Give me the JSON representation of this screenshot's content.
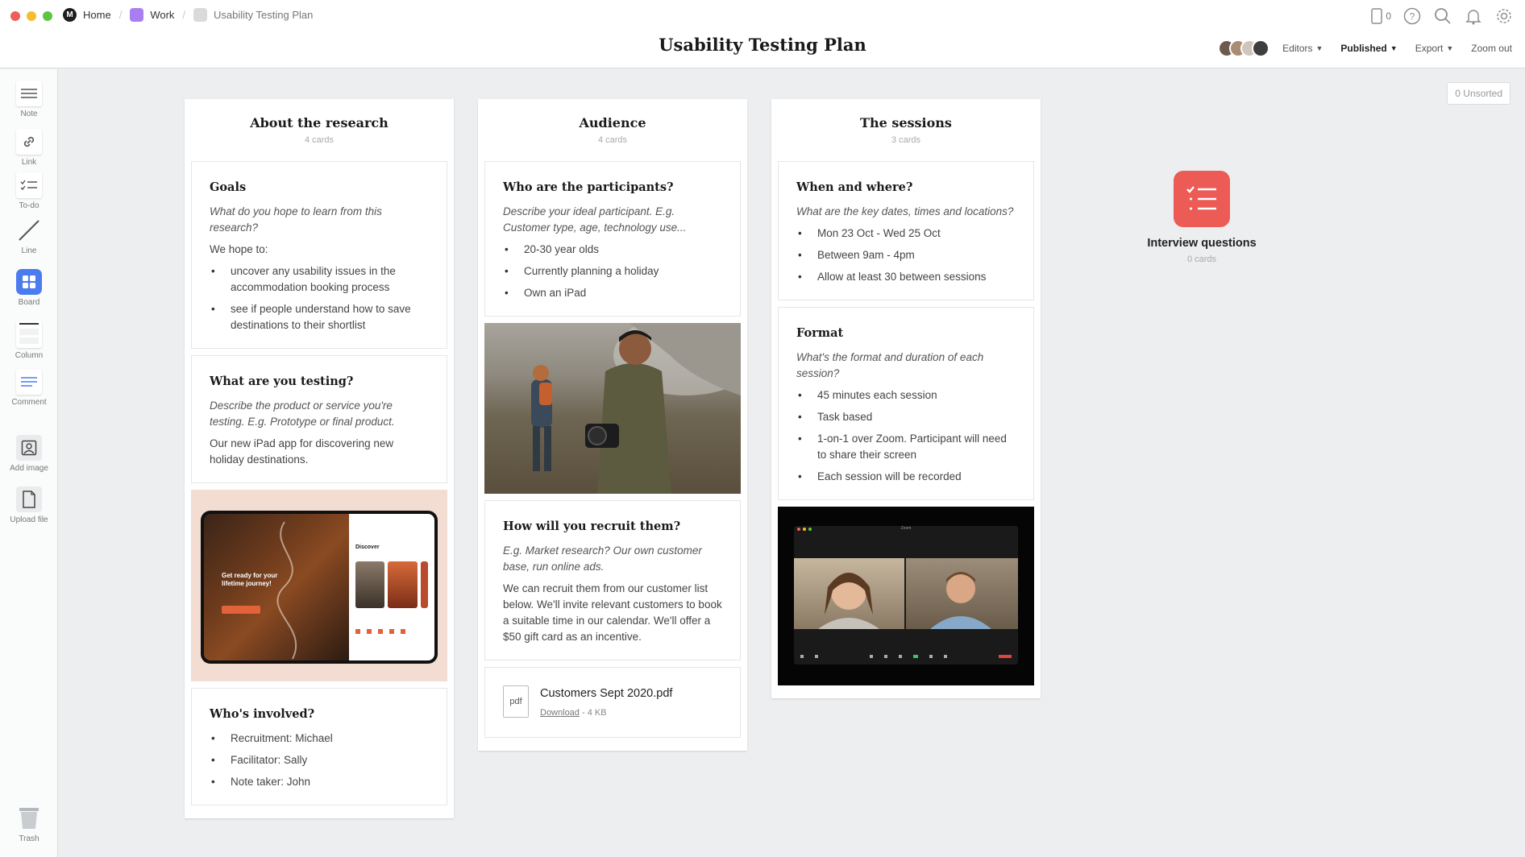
{
  "breadcrumbs": {
    "home": "Home",
    "work": "Work",
    "current": "Usability Testing Plan"
  },
  "title": "Usability Testing Plan",
  "header": {
    "device_count": "0",
    "editors": "Editors",
    "published": "Published",
    "export": "Export",
    "zoom_out": "Zoom out"
  },
  "sidebar": {
    "note": "Note",
    "link": "Link",
    "todo": "To-do",
    "line": "Line",
    "board": "Board",
    "column": "Column",
    "comment": "Comment",
    "add_image": "Add image",
    "upload_file": "Upload file",
    "trash": "Trash"
  },
  "unsorted": "0 Unsorted",
  "columns": [
    {
      "title": "About the research",
      "count": "4 cards",
      "cards": {
        "goals": {
          "title": "Goals",
          "desc": "What do you hope to learn from this research?",
          "text": "We hope to:",
          "items": [
            "uncover any usability issues in the accommodation booking process",
            "see if people understand how to save destinations to their shortlist"
          ]
        },
        "testing": {
          "title": "What are you testing?",
          "desc": "Describe the product or service you're testing. E.g. Prototype or final product.",
          "text": "Our new iPad app for discovering new holiday destinations."
        },
        "ipad": {
          "hero": "Get ready for your lifetime journey!",
          "discover": "Discover"
        },
        "involved": {
          "title": "Who's involved?",
          "items": [
            "Recruitment: Michael",
            "Facilitator: Sally",
            "Note taker: John"
          ]
        }
      }
    },
    {
      "title": "Audience",
      "count": "4 cards",
      "cards": {
        "participants": {
          "title": "Who are the participants?",
          "desc": "Describe your ideal participant. E.g. Customer type, age, technology use...",
          "items": [
            "20-30 year olds",
            "Currently planning a holiday",
            "Own an iPad"
          ]
        },
        "recruit": {
          "title": "How will you recruit them?",
          "desc": "E.g. Market research? Our own customer base, run online ads.",
          "text": "We can recruit them from our customer list below. We'll invite relevant customers to book a suitable time in our calendar. We'll offer a $50 gift card as an incentive."
        },
        "file": {
          "icon_label": "pdf",
          "name": "Customers Sept 2020.pdf",
          "download": "Download",
          "size": " - 4 KB"
        }
      }
    },
    {
      "title": "The sessions",
      "count": "3 cards",
      "cards": {
        "when": {
          "title": "When and where?",
          "desc": "What are the key dates, times and locations?",
          "items": [
            "Mon 23 Oct - Wed 25 Oct",
            "Between 9am - 4pm",
            "Allow at least 30 between sessions"
          ]
        },
        "format": {
          "title": "Format",
          "desc": "What's the format and duration of each session?",
          "items": [
            "45 minutes each session",
            "Task based",
            "1-on-1 over Zoom. Participant will need to share their screen",
            "Each session will be recorded"
          ]
        },
        "zoom": {
          "window_title": "Zoom"
        }
      }
    }
  ],
  "interview": {
    "title": "Interview questions",
    "count": "0 cards"
  },
  "colors": {
    "accent_red": "#ec5b55",
    "board_blue": "#4a7cf0",
    "work_purple": "#a97ef0"
  }
}
